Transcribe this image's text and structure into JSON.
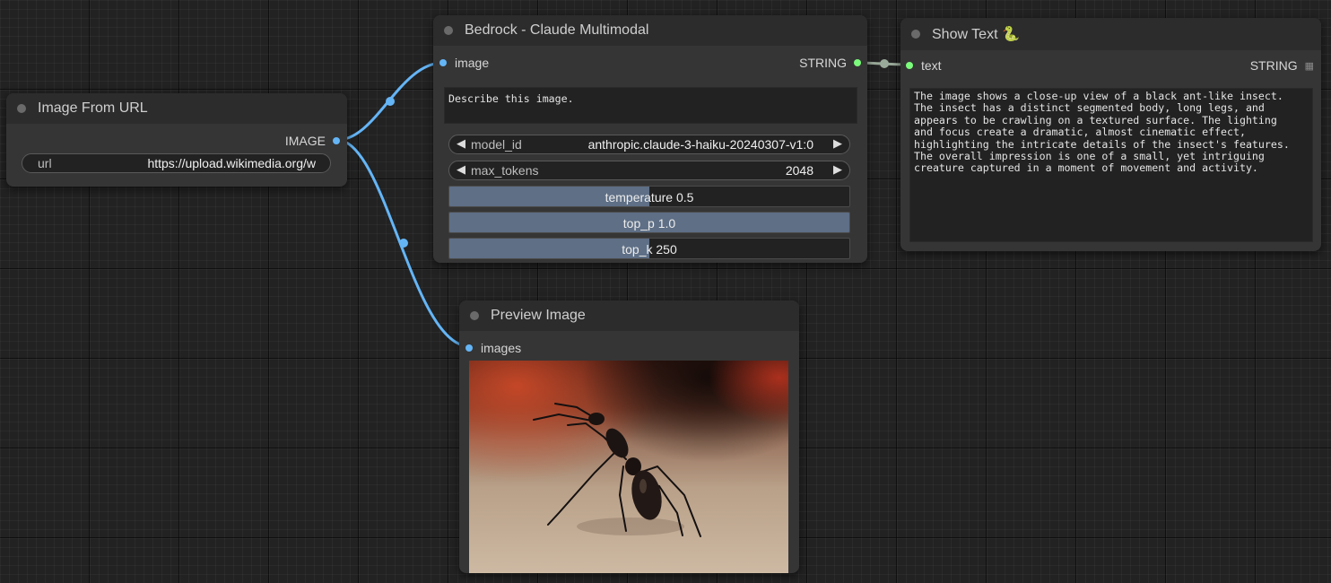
{
  "colors": {
    "image_link": "#64b5f6",
    "string_link": "#9aaa9a",
    "image_slot": "#64b5f6",
    "string_slot": "#7cfc7c"
  },
  "nodes": {
    "image_from_url": {
      "title": "Image From URL",
      "output_label": "IMAGE",
      "url_label": "url",
      "url_value": "https://upload.wikimedia.org/w"
    },
    "bedrock": {
      "title": "Bedrock - Claude Multimodal",
      "input_label": "image",
      "output_label": "STRING",
      "prompt": "Describe this image.",
      "model_id_label": "model_id",
      "model_id_value": "anthropic.claude-3-haiku-20240307-v1:0",
      "max_tokens_label": "max_tokens",
      "max_tokens_value": "2048",
      "temperature_text": "temperature  0.5",
      "temperature_fill": 0.5,
      "top_p_text": "top_p  1.0",
      "top_p_fill": 1.0,
      "top_k_text": "top_k  250",
      "top_k_fill": 0.5
    },
    "show_text": {
      "title": "Show Text 🐍",
      "input_label": "text",
      "output_label": "STRING",
      "output_icon": "grid-icon",
      "text": "The image shows a close-up view of a black ant-like insect.\nThe insect has a distinct segmented body, long legs, and\nappears to be crawling on a textured surface. The lighting\nand focus create a dramatic, almost cinematic effect,\nhighlighting the intricate details of the insect's features.\nThe overall impression is one of a small, yet intriguing\ncreature captured in a moment of movement and activity."
    },
    "preview": {
      "title": "Preview Image",
      "input_label": "images",
      "image_subject": "ant-photo"
    }
  }
}
